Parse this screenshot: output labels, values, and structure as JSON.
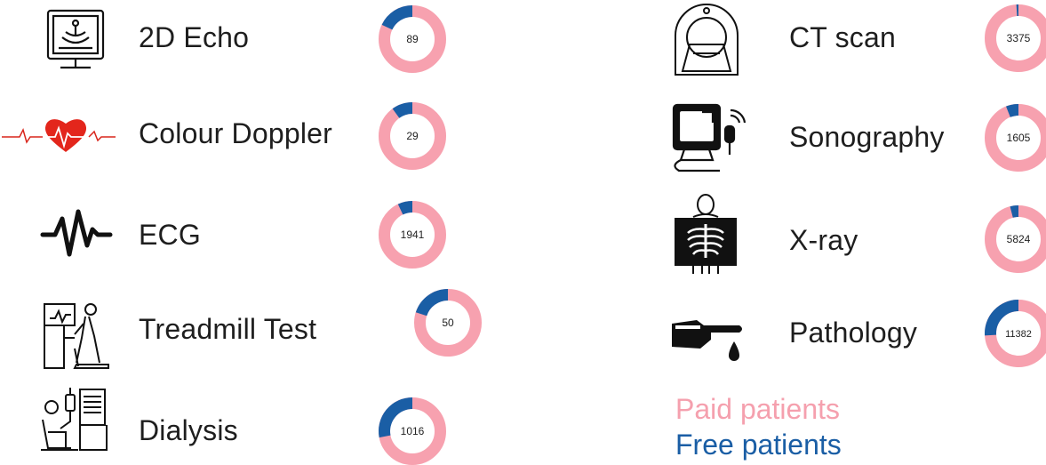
{
  "colors": {
    "paid": "#f7a1af",
    "free": "#1a5ea5",
    "center_text": "#222222"
  },
  "chart_data": {
    "type": "pie",
    "style": "donut",
    "legend": [
      {
        "label": "Paid patients",
        "color": "#f7a1af"
      },
      {
        "label": "Free patients",
        "color": "#1a5ea5"
      }
    ],
    "items": [
      {
        "name": "2D Echo",
        "icon": "echo-monitor-icon",
        "center_label": "89",
        "free_fraction": 0.18
      },
      {
        "name": "Colour Doppler",
        "icon": "heart-ecg-icon",
        "center_label": "29",
        "free_fraction": 0.1
      },
      {
        "name": "ECG",
        "icon": "ecg-wave-icon",
        "center_label": "1941",
        "free_fraction": 0.07
      },
      {
        "name": "Treadmill Test",
        "icon": "treadmill-icon",
        "center_label": "50",
        "free_fraction": 0.2
      },
      {
        "name": "Dialysis",
        "icon": "dialysis-icon",
        "center_label": "1016",
        "free_fraction": 0.28
      },
      {
        "name": "CT scan",
        "icon": "ct-scanner-icon",
        "center_label": "3375",
        "free_fraction": 0.01
      },
      {
        "name": "Sonography",
        "icon": "sonography-icon",
        "center_label": "1605",
        "free_fraction": 0.06
      },
      {
        "name": "X-ray",
        "icon": "xray-icon",
        "center_label": "5824",
        "free_fraction": 0.04
      },
      {
        "name": "Pathology",
        "icon": "pathology-icon",
        "center_label": "11382",
        "free_fraction": 0.26
      }
    ]
  }
}
